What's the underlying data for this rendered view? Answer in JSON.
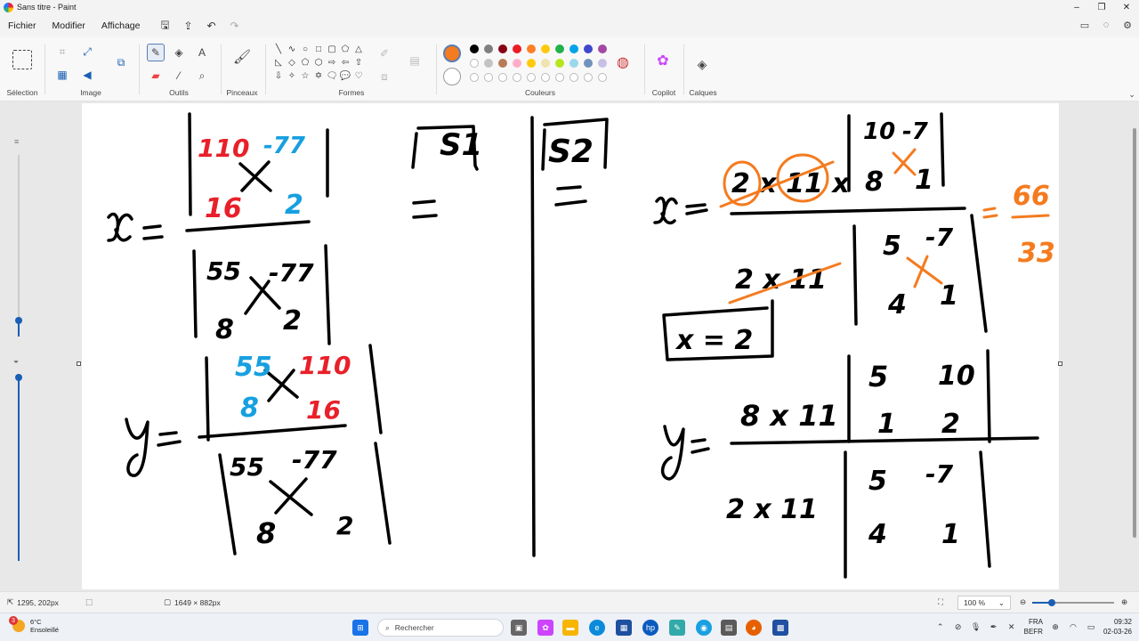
{
  "window": {
    "title": "Sans titre - Paint"
  },
  "menu": [
    "Fichier",
    "Modifier",
    "Affichage"
  ],
  "ribbon": {
    "groups": {
      "selection": "Sélection",
      "image": "Image",
      "tools": "Outils",
      "brushes": "Pinceaux",
      "shapes": "Formes",
      "colors": "Couleurs",
      "copilot": "Copilot",
      "layers": "Calques"
    },
    "active_color": "#f47b20",
    "palette_row1": [
      "#000000",
      "#7f7f7f",
      "#880015",
      "#ed1c24",
      "#ff7f27",
      "#ffc90e",
      "#22b14c",
      "#00a2e8",
      "#3f48cc",
      "#a349a4"
    ],
    "palette_row2": [
      "#ffffff",
      "#c3c3c3",
      "#b97a57",
      "#ffaec9",
      "#ffc90e",
      "#efe4b0",
      "#b5e61d",
      "#99d9ea",
      "#7092be",
      "#c8bfe7"
    ]
  },
  "status": {
    "cursor_pos": "1295, 202px",
    "canvas_size": "1649 × 882px",
    "zoom": "100 %"
  },
  "taskbar": {
    "weather_temp": "6°C",
    "weather_desc": "Ensoleillé",
    "weather_badge": "3",
    "search_placeholder": "Rechercher",
    "lang1": "FRA",
    "lang2": "BEFR",
    "time": "09:32",
    "date": "02-03-26"
  },
  "drawing": {
    "S1": "S1",
    "S2": "S2",
    "x_var": "x",
    "y_var": "y",
    "eq": "=",
    "det_x_num": [
      "110",
      "-77",
      "16",
      "2"
    ],
    "det_main": [
      "55",
      "-77",
      "8",
      "2"
    ],
    "det_y_num": [
      "55",
      "110",
      "8",
      "16"
    ],
    "s2_x_num": [
      "10",
      "-7",
      "8",
      "1"
    ],
    "s2_x_factor": "2 x 11 x",
    "s2_den": [
      "5",
      "-7",
      "4",
      "1"
    ],
    "s2_den_factor": "2 x 11",
    "s2_result": "66",
    "s2_result_den": "33",
    "s2_x_answer": "x = 2",
    "s2_y_num": [
      "5",
      "10",
      "1",
      "2"
    ],
    "s2_y_factor": "8 x 11",
    "s2_y_den_factor": "2 x 11"
  }
}
